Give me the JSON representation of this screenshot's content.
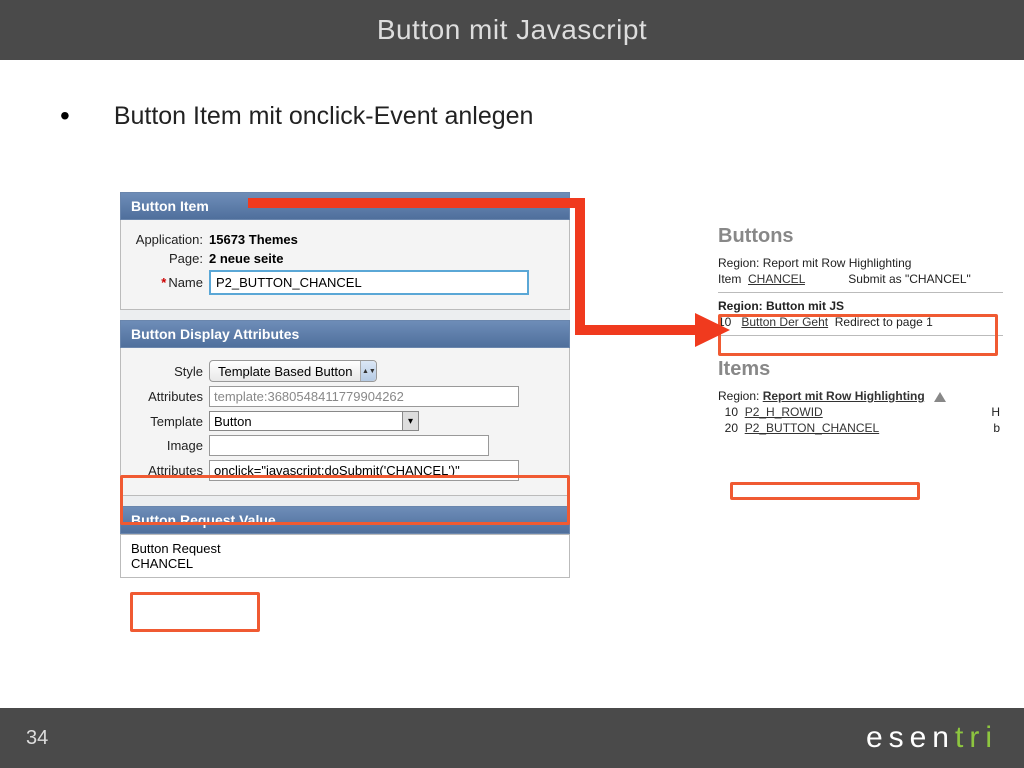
{
  "header": {
    "title": "Button mit Javascript"
  },
  "bullet": {
    "text": "Button Item mit onclick-Event anlegen"
  },
  "panels": {
    "item": {
      "title": "Button Item",
      "application_label": "Application:",
      "application_value": "15673 Themes",
      "page_label": "Page:",
      "page_value": "2 neue seite",
      "name_label": "Name",
      "name_value": "P2_BUTTON_CHANCEL"
    },
    "display": {
      "title": "Button Display Attributes",
      "style_label": "Style",
      "style_value": "Template Based Button",
      "attributes1_label": "Attributes",
      "attributes1_value": "template:3680548411779904262",
      "template_label": "Template",
      "template_value": "Button",
      "image_label": "Image",
      "image_value": "",
      "attributes2_label": "Attributes",
      "attributes2_value": "onclick=\"javascript:doSubmit('CHANCEL')\""
    },
    "request": {
      "title": "Button Request Value",
      "label": "Button Request",
      "value": "CHANCEL"
    }
  },
  "right": {
    "buttons_title": "Buttons",
    "region1_label": "Region:",
    "region1_value": "Report mit Row Highlighting",
    "item_label": "Item",
    "item_link": "CHANCEL",
    "submit_as": "Submit as \"CHANCEL\"",
    "region2_label": "Region:",
    "region2_value": "Button mit JS",
    "row2_seq": "10",
    "row2_link": "Button Der Geht",
    "row2_note": "Redirect to page 1",
    "items_title": "Items",
    "region3_label": "Region:",
    "region3_link": "Report mit Row Highlighting",
    "irow1_seq": "10",
    "irow1_link": "P2_H_ROWID",
    "irow1_suffix": "H",
    "irow2_seq": "20",
    "irow2_link": "P2_BUTTON_CHANCEL",
    "irow2_suffix": "b"
  },
  "footer": {
    "page": "34",
    "logo_plain": "esen",
    "logo_accent": "tri"
  }
}
